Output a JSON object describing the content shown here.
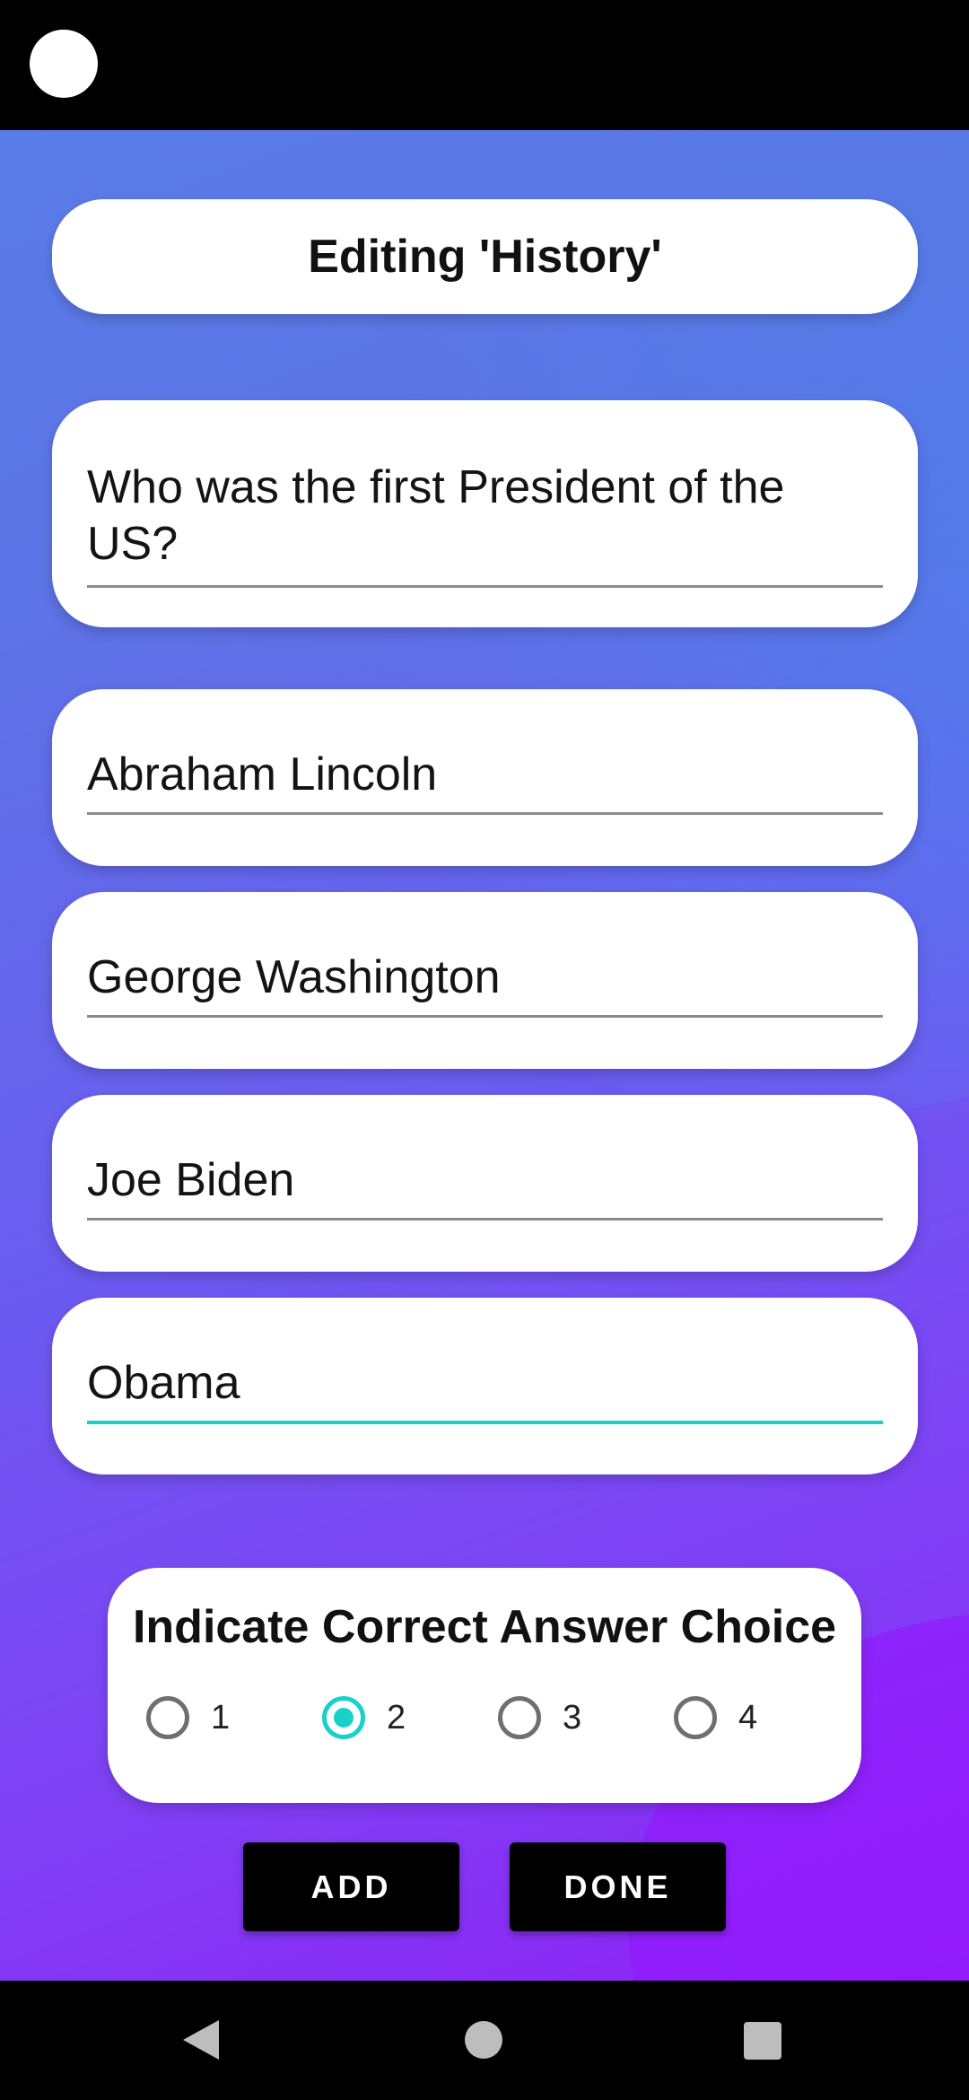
{
  "header": {
    "title": "Editing 'History'"
  },
  "question": {
    "value": "Who was the first President of the US?"
  },
  "answers": [
    {
      "value": "Abraham Lincoln"
    },
    {
      "value": "George Washington"
    },
    {
      "value": "Joe Biden"
    },
    {
      "value": "Obama"
    }
  ],
  "correct_choice": {
    "title": "Indicate Correct Answer Choice",
    "options": [
      "1",
      "2",
      "3",
      "4"
    ],
    "selected": "2"
  },
  "buttons": {
    "add_label": "ADD",
    "done_label": "DONE"
  },
  "colors": {
    "accent": "#1ad1c9",
    "background_top": "#5a7de8",
    "background_bottom": "#8e22f5"
  }
}
